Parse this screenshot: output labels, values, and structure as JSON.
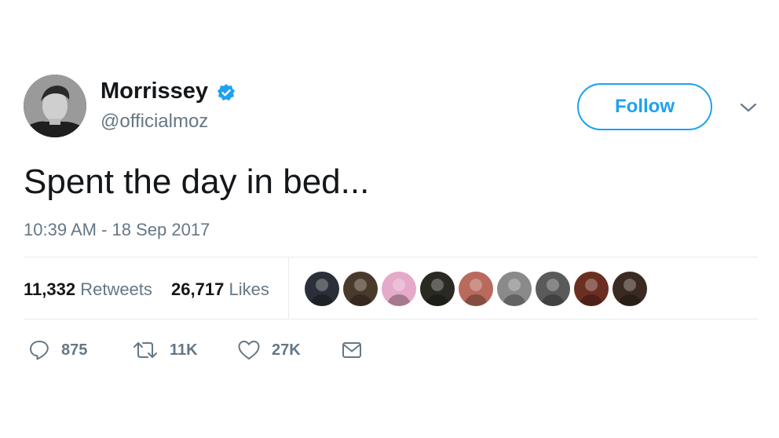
{
  "user": {
    "display_name": "Morrissey",
    "handle": "@officialmoz",
    "verified": true
  },
  "follow_button": {
    "label": "Follow"
  },
  "tweet": {
    "text": "Spent the day in bed...",
    "timestamp": "10:39 AM - 18 Sep 2017"
  },
  "stats": {
    "retweets": {
      "count": "11,332",
      "label": "Retweets"
    },
    "likes": {
      "count": "26,717",
      "label": "Likes"
    }
  },
  "liker_avatars": [
    {
      "color": "#2b2f3a"
    },
    {
      "color": "#4a3a2c"
    },
    {
      "color": "#e5a9c9"
    },
    {
      "color": "#2a2a22"
    },
    {
      "color": "#b96a5c"
    },
    {
      "color": "#8a8a8a"
    },
    {
      "color": "#5a5a5a"
    },
    {
      "color": "#6b2f22"
    },
    {
      "color": "#3b2a22"
    }
  ],
  "actions": {
    "reply": {
      "count": "875",
      "icon": "reply-icon"
    },
    "retweet": {
      "count": "11K",
      "icon": "retweet-icon"
    },
    "like": {
      "count": "27K",
      "icon": "heart-icon"
    },
    "message": {
      "icon": "envelope-icon"
    }
  },
  "colors": {
    "accent": "#1da1f2",
    "muted": "#657786",
    "text": "#14171a",
    "divider": "#e6ecf0"
  }
}
